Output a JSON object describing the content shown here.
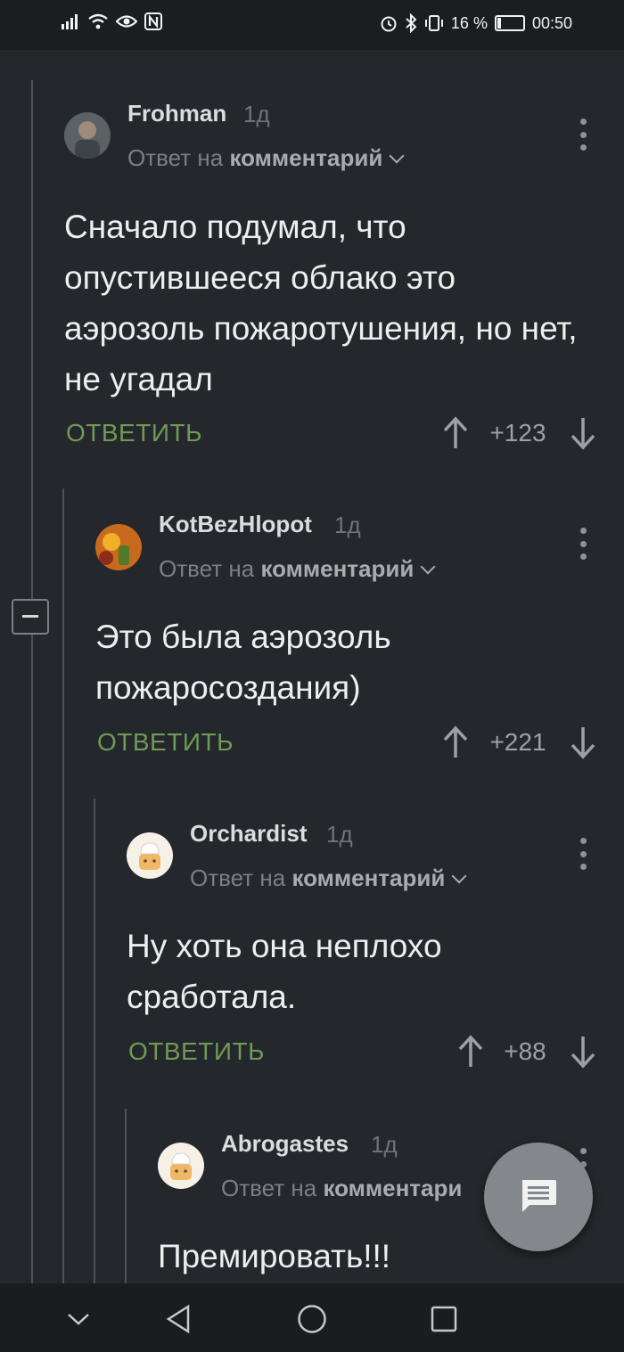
{
  "status_bar": {
    "battery_text": "16 %",
    "battery_level": 0.16,
    "time": "00:50",
    "left_icons": [
      "signal-icon",
      "wifi-icon",
      "eye-icon",
      "nfc-icon"
    ],
    "right_icons": [
      "alarm-icon",
      "bluetooth-icon",
      "vibrate-icon",
      "battery-icon"
    ]
  },
  "comments": [
    {
      "author": "Frohman",
      "age": "1д",
      "reply_prefix": "Ответ на",
      "reply_target": "комментарий",
      "text": "Сначало подумал, что опустившееся облако это аэрозоль пожаротушения, но нет, не угадал",
      "reply_label": "ОТВЕТИТЬ",
      "score": "+123"
    },
    {
      "author": "KotBezHlopot",
      "age": "1д",
      "reply_prefix": "Ответ на",
      "reply_target": "комментарий",
      "text": "Это была аэрозоль пожаросоздания)",
      "reply_label": "ОТВЕТИТЬ",
      "score": "+221"
    },
    {
      "author": "Orchardist",
      "age": "1д",
      "reply_prefix": "Ответ на",
      "reply_target": "комментарий",
      "text": "Ну хоть она неплохо сработала.",
      "reply_label": "ОТВЕТИТЬ",
      "score": "+88"
    },
    {
      "author": "Abrogastes",
      "age": "1д",
      "reply_prefix": "Ответ на",
      "reply_target": "комментари",
      "text": "Премировать!!!"
    }
  ],
  "fab_icon": "comment-icon",
  "collapse_icon": "minus-icon",
  "nav_bar": [
    "hide-keyboard-icon",
    "back-icon",
    "home-icon",
    "recents-icon"
  ],
  "colors": {
    "background": "#24272b",
    "reply_green": "#6f9a57",
    "thread_line": "#4e5258"
  }
}
